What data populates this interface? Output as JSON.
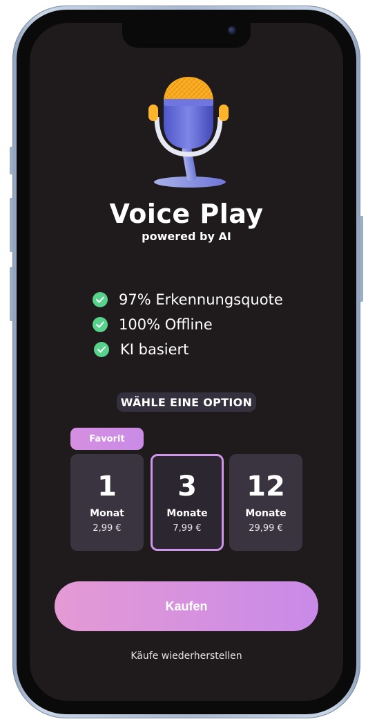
{
  "app": {
    "title": "Voice Play",
    "subtitle": "powered by AI",
    "icon": "microphone-icon"
  },
  "features": [
    {
      "label": "97% Erkennungsquote",
      "icon": "check-icon"
    },
    {
      "label": "100% Offline",
      "icon": "check-icon"
    },
    {
      "label": "KI basiert",
      "icon": "check-icon"
    }
  ],
  "options": {
    "heading": "WÄHLE EINE OPTION",
    "favorite_badge": "Favorit",
    "plans": [
      {
        "number": "1",
        "unit": "Monat",
        "price": "2,99 €",
        "selected": false
      },
      {
        "number": "3",
        "unit": "Monate",
        "price": "7,99 €",
        "selected": true
      },
      {
        "number": "12",
        "unit": "Monate",
        "price": "29,99 €",
        "selected": false
      }
    ]
  },
  "actions": {
    "buy_label": "Kaufen",
    "restore_label": "Käufe wiederherstellen"
  },
  "colors": {
    "background": "#1f1a1c",
    "accent": "#cf95e8",
    "check": "#58d28b"
  }
}
